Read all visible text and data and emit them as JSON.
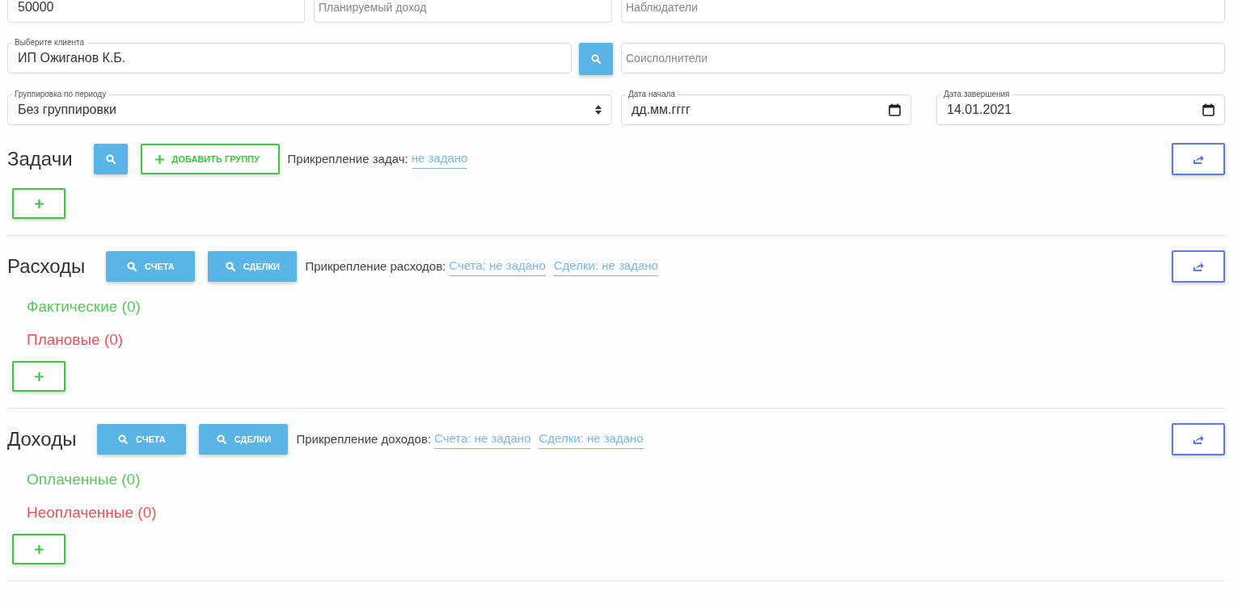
{
  "row1": [
    {
      "value": "50000"
    },
    {
      "placeholder": "Планируемый доход"
    },
    {
      "placeholder": "Наблюдатели"
    }
  ],
  "client": {
    "label": "Выберите клиента",
    "value": "ИП Ожиганов К.Б."
  },
  "co_executors": {
    "placeholder": "Соисполнители"
  },
  "grouping": {
    "label": "Группировка по периоду",
    "value": "Без группировки"
  },
  "start_date": {
    "label": "Дата начала",
    "value": "дд.мм.гггг"
  },
  "end_date": {
    "label": "Дата завершения",
    "value": "14.01.2021"
  },
  "sections": [
    {
      "title": "Задачи",
      "buttons": [
        {
          "kind": "search"
        },
        {
          "kind": "add",
          "label": "ДОБАВИТЬ ГРУППУ"
        }
      ],
      "attach_label": "Прикрепление задач:",
      "links": [
        "не задано"
      ]
    },
    {
      "title": "Расходы",
      "buttons": [
        {
          "kind": "search",
          "label": "СЧЕТА"
        },
        {
          "kind": "search",
          "label": "СДЕЛКИ"
        }
      ],
      "attach_label": "Прикрепление расходов:",
      "links": [
        "Счета: не задано",
        "Сделки: не задано"
      ],
      "groups": [
        {
          "label": "Фактические (0)",
          "color": "#5cc85c"
        },
        {
          "label": "Плановые (0)",
          "color": "#f0505a"
        }
      ]
    },
    {
      "title": "Доходы",
      "buttons": [
        {
          "kind": "search",
          "label": "СЧЕТА"
        },
        {
          "kind": "search",
          "label": "СДЕЛКИ"
        }
      ],
      "attach_label": "Прикрепление доходов:",
      "links": [
        "Счета: не задано",
        "Сделки: не задано"
      ],
      "groups": [
        {
          "label": "Оплаченные (0)",
          "color": "#5cc85c"
        },
        {
          "label": "Неоплаченные (0)",
          "color": "#f0505a"
        }
      ]
    }
  ]
}
